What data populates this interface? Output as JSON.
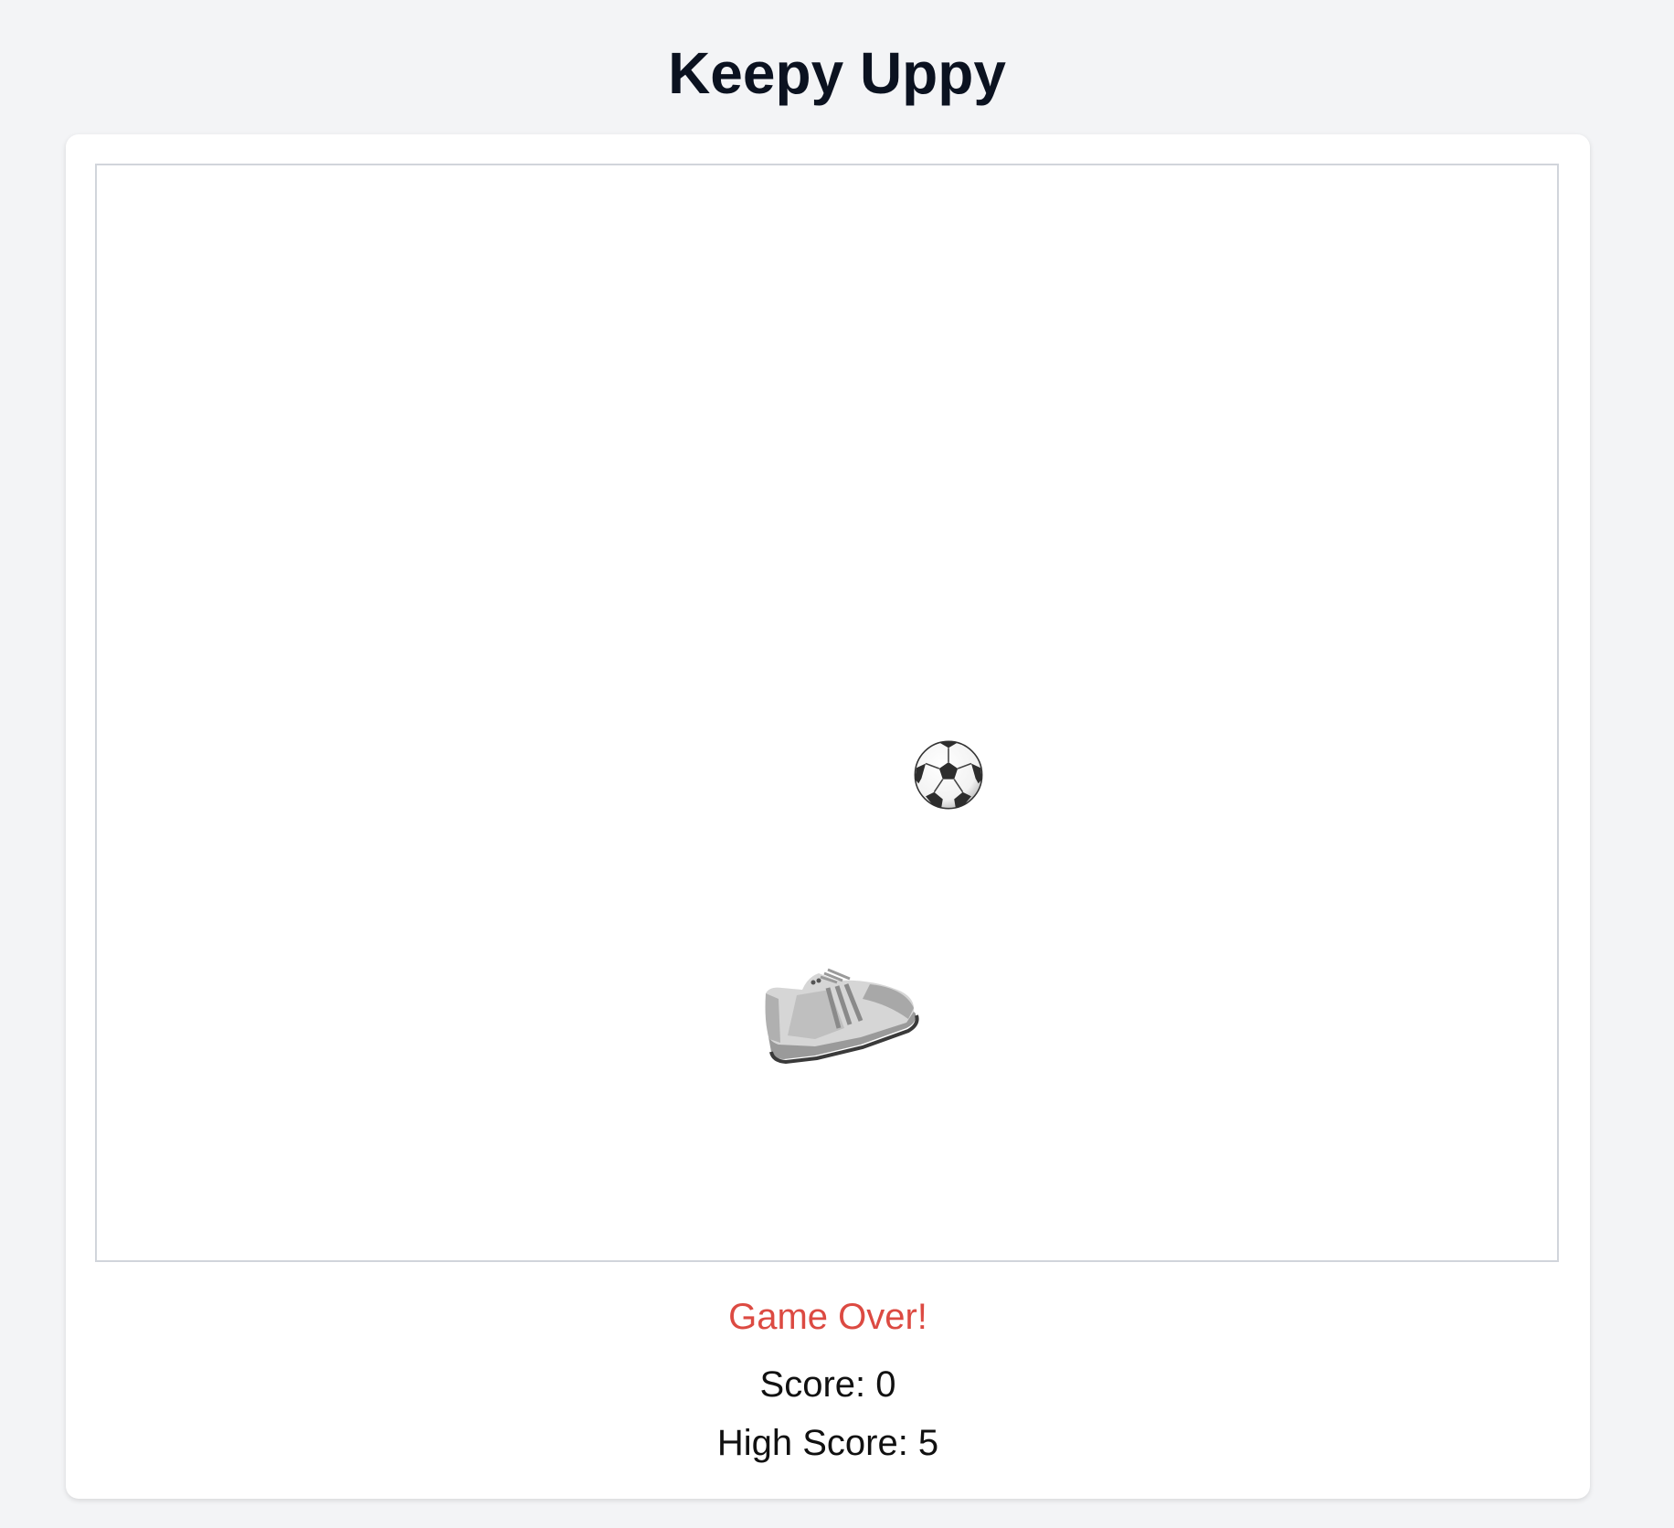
{
  "header": {
    "title": "Keepy Uppy"
  },
  "game": {
    "ball_icon": "soccer-ball-icon",
    "foot_icon": "sneaker-icon"
  },
  "status": {
    "message": "Game Over!",
    "message_color": "#dc4a42",
    "score_text": "Score: 0",
    "high_score_text": "High Score: 5"
  },
  "colors": {
    "page_background": "#f3f4f6",
    "card_background": "#ffffff",
    "canvas_border": "#d1d5db"
  }
}
